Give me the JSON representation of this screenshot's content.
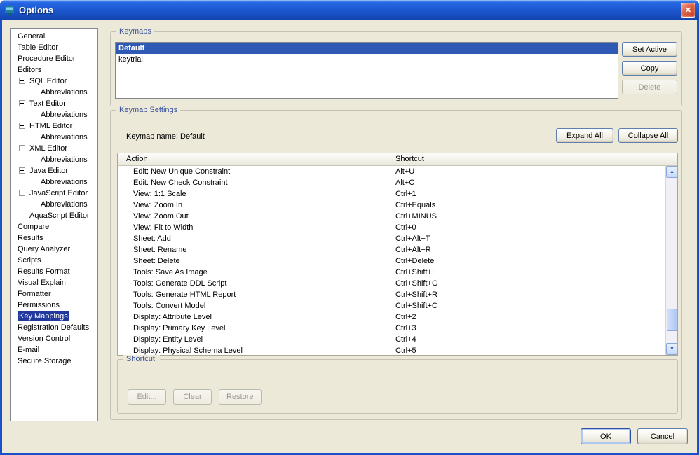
{
  "window": {
    "title": "Options"
  },
  "icons": {
    "close": "✕",
    "scroll_up": "▲",
    "scroll_down": "▼"
  },
  "colors": {
    "frame_blue": "#1A50C8",
    "dialog_bg": "#ECE9D8",
    "group_title": "#39539B",
    "sidebar_selection": "#21399E",
    "keymap_selection": "#2E59B4",
    "button_border": "#5F7FAE",
    "disabled_text": "#9B988C",
    "close_red": "#C33B1E",
    "scroll_accent": "#3D5E9E"
  },
  "sidebar": {
    "items": [
      {
        "label": "General",
        "indent": 0
      },
      {
        "label": "Table Editor",
        "indent": 0
      },
      {
        "label": "Procedure Editor",
        "indent": 0
      },
      {
        "label": "Editors",
        "indent": 0
      },
      {
        "label": "SQL Editor",
        "indent": 1,
        "expander": "minus"
      },
      {
        "label": "Abbreviations",
        "indent": 2
      },
      {
        "label": "Text Editor",
        "indent": 1,
        "expander": "minus"
      },
      {
        "label": "Abbreviations",
        "indent": 2
      },
      {
        "label": "HTML Editor",
        "indent": 1,
        "expander": "minus"
      },
      {
        "label": "Abbreviations",
        "indent": 2
      },
      {
        "label": "XML Editor",
        "indent": 1,
        "expander": "minus"
      },
      {
        "label": "Abbreviations",
        "indent": 2
      },
      {
        "label": "Java Editor",
        "indent": 1,
        "expander": "minus"
      },
      {
        "label": "Abbreviations",
        "indent": 2
      },
      {
        "label": "JavaScript Editor",
        "indent": 1,
        "expander": "minus"
      },
      {
        "label": "Abbreviations",
        "indent": 2
      },
      {
        "label": "AquaScript Editor",
        "indent": 1
      },
      {
        "label": "Compare",
        "indent": 0
      },
      {
        "label": "Results",
        "indent": 0
      },
      {
        "label": "Query Analyzer",
        "indent": 0
      },
      {
        "label": "Scripts",
        "indent": 0
      },
      {
        "label": "Results Format",
        "indent": 0
      },
      {
        "label": "Visual Explain",
        "indent": 0
      },
      {
        "label": "Formatter",
        "indent": 0
      },
      {
        "label": "Permissions",
        "indent": 0
      },
      {
        "label": "Key Mappings",
        "indent": 0,
        "selected": true
      },
      {
        "label": "Registration Defaults",
        "indent": 0
      },
      {
        "label": "Version Control",
        "indent": 0
      },
      {
        "label": "E-mail",
        "indent": 0
      },
      {
        "label": "Secure Storage",
        "indent": 0
      }
    ]
  },
  "keymaps": {
    "title": "Keymaps",
    "items": [
      {
        "label": "Default",
        "selected": true
      },
      {
        "label": "keytrial"
      }
    ],
    "buttons": [
      {
        "label": "Set Active",
        "enabled": true
      },
      {
        "label": "Copy",
        "enabled": true
      },
      {
        "label": "Delete",
        "enabled": false
      }
    ]
  },
  "settings": {
    "title": "Keymap Settings",
    "keymap_name_label": "Keymap name: Default",
    "expand_all_label": "Expand All",
    "collapse_all_label": "Collapse All",
    "table": {
      "columns": [
        "Action",
        "Shortcut"
      ],
      "rows": [
        {
          "action": "Edit: New Unique Constraint",
          "shortcut": "Alt+U"
        },
        {
          "action": "Edit: New Check Constraint",
          "shortcut": "Alt+C"
        },
        {
          "action": "View: 1:1 Scale",
          "shortcut": "Ctrl+1"
        },
        {
          "action": "View: Zoom In",
          "shortcut": "Ctrl+Equals"
        },
        {
          "action": "View: Zoom Out",
          "shortcut": "Ctrl+MINUS"
        },
        {
          "action": "View: Fit to Width",
          "shortcut": "Ctrl+0"
        },
        {
          "action": "Sheet: Add",
          "shortcut": "Ctrl+Alt+T"
        },
        {
          "action": "Sheet: Rename",
          "shortcut": "Ctrl+Alt+R"
        },
        {
          "action": "Sheet: Delete",
          "shortcut": "Ctrl+Delete"
        },
        {
          "action": "Tools: Save As Image",
          "shortcut": "Ctrl+Shift+I"
        },
        {
          "action": "Tools: Generate DDL Script",
          "shortcut": "Ctrl+Shift+G"
        },
        {
          "action": "Tools: Generate HTML Report",
          "shortcut": "Ctrl+Shift+R"
        },
        {
          "action": "Tools: Convert Model",
          "shortcut": "Ctrl+Shift+C"
        },
        {
          "action": "Display: Attribute Level",
          "shortcut": "Ctrl+2"
        },
        {
          "action": "Display: Primary Key Level",
          "shortcut": "Ctrl+3"
        },
        {
          "action": "Display: Entity Level",
          "shortcut": "Ctrl+4"
        },
        {
          "action": "Display: Physical Schema Level",
          "shortcut": "Ctrl+5"
        }
      ]
    }
  },
  "shortcut": {
    "title": "Shortcut:",
    "buttons": [
      {
        "label": "Edit...",
        "enabled": false
      },
      {
        "label": "Clear",
        "enabled": false
      },
      {
        "label": "Restore",
        "enabled": false
      }
    ]
  },
  "dialog_buttons": {
    "ok_label": "OK",
    "cancel_label": "Cancel"
  }
}
